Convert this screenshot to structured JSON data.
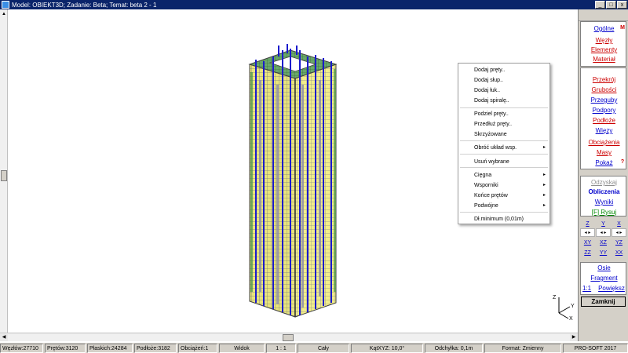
{
  "window": {
    "title": "Model: OBIEKT3D;  Zadanie: Beta;  Temat: beta 2 - 1",
    "minimize": "_",
    "maximize": "□",
    "close": "x"
  },
  "right_panel": {
    "group1": [
      {
        "label": "Ogólne",
        "color": "blue"
      },
      {
        "label": "Węzły",
        "color": "red"
      },
      {
        "label": "Elementy",
        "color": "red"
      },
      {
        "label": "Materiał",
        "color": "red"
      }
    ],
    "group1_mark": "M",
    "group2": [
      {
        "label": "Przekrój",
        "color": "red"
      },
      {
        "label": "Grubości",
        "color": "red"
      },
      {
        "label": "Przeguby",
        "color": "blue"
      },
      {
        "label": "Podpory",
        "color": "blue"
      },
      {
        "label": "Podłoże",
        "color": "red"
      },
      {
        "label": "Więzy",
        "color": "blue"
      },
      {
        "label": "Obciążenia",
        "color": "red"
      },
      {
        "label": "Masy",
        "color": "red"
      },
      {
        "label": "Pokaż",
        "color": "blue"
      }
    ],
    "help_mark": "?",
    "group3": [
      {
        "label": "Odzyskaj",
        "color": "gray"
      },
      {
        "label": "Obliczenia",
        "color": "blue"
      },
      {
        "label": "Wyniki",
        "color": "blue"
      },
      {
        "label": "[F] Rysuj",
        "color": "green"
      }
    ],
    "directions": {
      "row1": [
        "Z",
        "Y",
        "X"
      ],
      "row2": [
        "XY",
        "XZ",
        "YZ"
      ],
      "row3": [
        "ZZ",
        "YY",
        "XX"
      ]
    },
    "group4": [
      {
        "label": "Osie",
        "color": "blue"
      },
      {
        "label": "Fragment",
        "color": "blue"
      }
    ],
    "zoom_1to1": "1:1",
    "zoom_enlarge": "Powiększ",
    "close_button": "Zamknij"
  },
  "context_menu": {
    "items": [
      {
        "label": "Dodaj pręty..",
        "submenu": false
      },
      {
        "label": "Dodaj słup..",
        "submenu": false
      },
      {
        "label": "Dodaj łuk..",
        "submenu": false
      },
      {
        "label": "Dodaj spiralę..",
        "submenu": false
      },
      {
        "label": "Podziel pręty..",
        "submenu": false
      },
      {
        "label": "Przedłuż pręty..",
        "submenu": false
      },
      {
        "label": "Skrzyżowane",
        "submenu": false
      },
      {
        "label": "Obróć układ wsp.",
        "submenu": true
      },
      {
        "label": "Usuń wybrane",
        "submenu": false
      },
      {
        "label": "Cięgna",
        "submenu": true
      },
      {
        "label": "Wsporniki",
        "submenu": true
      },
      {
        "label": "Końce prętów",
        "submenu": true
      },
      {
        "label": "Podwójne",
        "submenu": true
      },
      {
        "label": "Dł.minimum (0,01m)",
        "submenu": false
      }
    ],
    "submenu_arrow": "▸"
  },
  "status_bar": {
    "nodes": "Węzłów:27710",
    "bars": "Prętów:3120",
    "planes": "Płaskich:24284",
    "subsoil": "Podłoże:3182",
    "loads": "Obciążeń:1",
    "view": "Widok",
    "scale": "1 : 1",
    "extent": "Cały",
    "angle": "KątXYZ: 10,0°",
    "spacing": "Odchyłka: 0,1m",
    "format": "Format: Zmienny",
    "brand": "PRO-SOFT 2017"
  },
  "axis_labels": {
    "z": "Z",
    "y": "Y",
    "x": "X"
  },
  "colors": {
    "titlebar": "#0a246a",
    "panel": "#d4d0c8",
    "mesh": "#f2ee8a",
    "bars": "#1a1acc",
    "link_red": "#cc0000",
    "link_blue": "#0000cc"
  }
}
